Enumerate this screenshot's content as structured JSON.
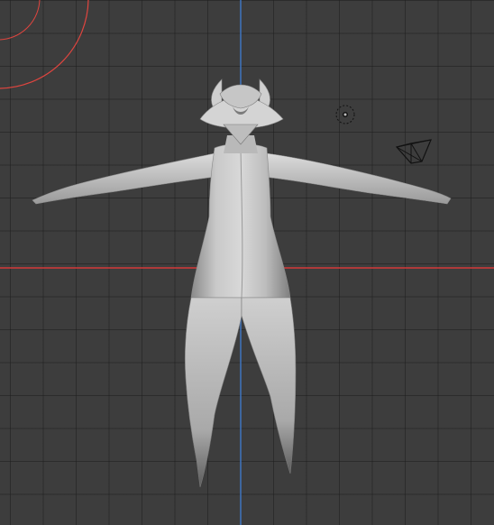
{
  "viewport": {
    "mode": "3d-viewport",
    "background_color": "#3d3d3d",
    "grid_color": "#2a2a2a",
    "axis_x_color": "#d43a3a",
    "axis_y_color": "#3f79c9",
    "light_circle_color": "#e0453f"
  },
  "scene_objects": [
    {
      "name": "character-mesh",
      "type": "mesh",
      "shading": "solid"
    },
    {
      "name": "camera",
      "type": "camera"
    },
    {
      "name": "light",
      "type": "light"
    }
  ]
}
